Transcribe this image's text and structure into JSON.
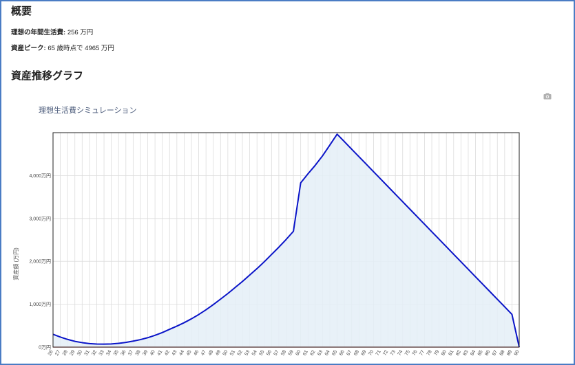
{
  "overview": {
    "heading": "概要",
    "ideal_label": "理想の年間生活費:",
    "ideal_value": "256 万円",
    "peak_label": "資産ピーク:",
    "peak_value": "65 歳時点で 4965 万円"
  },
  "graph_section": {
    "heading": "資産推移グラフ"
  },
  "chart_data": {
    "type": "area",
    "title": "理想生活費シミュレーション",
    "ylabel": "資産額 (万円)",
    "xlabel": "",
    "ylim": [
      0,
      5000
    ],
    "yticks": [
      0,
      1000,
      2000,
      3000,
      4000
    ],
    "ytick_labels": [
      "0万円",
      "1,000万円",
      "2,000万円",
      "3,000万円",
      "4,000万円"
    ],
    "xlim": [
      26,
      90
    ],
    "grid": true,
    "line_color": "#0a14c8",
    "fill_color": "#e4eef7",
    "zero_line_color": "#f0a0a0",
    "x": [
      26,
      27,
      28,
      29,
      30,
      31,
      32,
      33,
      34,
      35,
      36,
      37,
      38,
      39,
      40,
      41,
      42,
      43,
      44,
      45,
      46,
      47,
      48,
      49,
      50,
      51,
      52,
      53,
      54,
      55,
      56,
      57,
      58,
      59,
      60,
      61,
      62,
      63,
      64,
      65,
      66,
      67,
      68,
      69,
      70,
      71,
      72,
      73,
      74,
      75,
      76,
      77,
      78,
      79,
      80,
      81,
      82,
      83,
      84,
      85,
      86,
      87,
      88,
      89,
      90
    ],
    "series": [
      {
        "values": [
          300,
          235,
          180,
          135,
          105,
          82,
          72,
          70,
          75,
          88,
          110,
          140,
          175,
          220,
          275,
          340,
          415,
          490,
          570,
          660,
          760,
          870,
          990,
          1120,
          1250,
          1390,
          1530,
          1680,
          1830,
          1990,
          2160,
          2330,
          2510,
          2700,
          3830,
          4040,
          4240,
          4460,
          4710,
          4965,
          4790,
          4615,
          4440,
          4265,
          4090,
          3915,
          3740,
          3565,
          3390,
          3215,
          3040,
          2865,
          2690,
          2515,
          2340,
          2165,
          1990,
          1815,
          1640,
          1465,
          1290,
          1115,
          940,
          765,
          0
        ]
      }
    ]
  }
}
